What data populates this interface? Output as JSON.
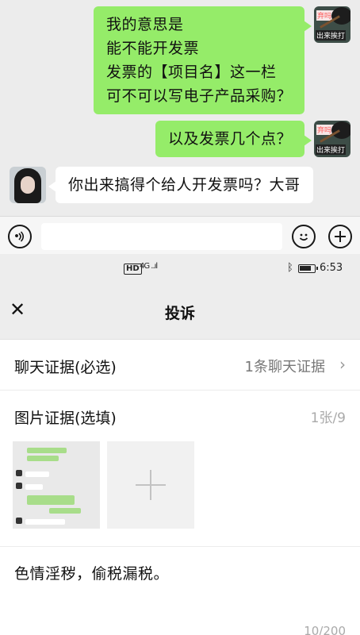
{
  "chat": {
    "messages": [
      {
        "side": "out",
        "lines": [
          "我的意思是",
          "能不能开发票",
          "发票的【项目名】这一栏",
          "可不可以写电子产品采购？"
        ]
      },
      {
        "side": "out",
        "text": "以及发票几个点？"
      },
      {
        "side": "in",
        "text": "你出来搞得个给人开发票吗？大哥"
      }
    ],
    "sticker_avatar": {
      "top_text": "弃吗？",
      "bottom_text": "出来挨打"
    }
  },
  "status_bar": {
    "hd": "HD",
    "signal": "4G ..ıl",
    "time": "6:53",
    "battery_level": 0.8
  },
  "complaint": {
    "title": "投诉",
    "chat_evidence": {
      "label": "聊天证据(必选)",
      "value": "1条聊天证据"
    },
    "image_evidence": {
      "label": "图片证据(选填)",
      "count": "1张/9"
    },
    "description": "色情淫秽，偷税漏税。",
    "char_count": "10/200"
  }
}
